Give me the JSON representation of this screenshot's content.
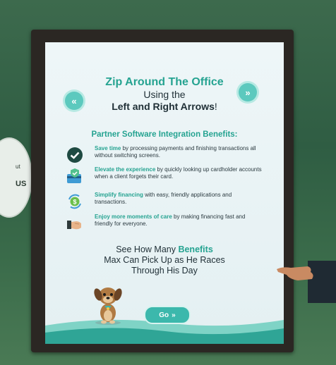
{
  "screen": {
    "title_line1": "Zip Around The Office",
    "title_line2": "Using the",
    "title_line3_bold": "Left and Right Arrows",
    "title_line3_end": "!",
    "arrow_left": "«",
    "arrow_right": "»",
    "benefits_heading": "Partner Software Integration Benefits:",
    "benefits": [
      {
        "icon": "check-circle-icon",
        "highlight": "Save time",
        "rest": " by processing payments and finishing transactions all without switching screens."
      },
      {
        "icon": "shield-card-icon",
        "highlight": "Elevate the experience",
        "rest": " by quickly looking up cardholder accounts when a client forgets their card."
      },
      {
        "icon": "refresh-dollar-icon",
        "highlight": "Simplify financing",
        "rest": " with easy, friendly applications and transactions."
      },
      {
        "icon": "handshake-icon",
        "highlight": "Enjoy more moments of care",
        "rest": " by making financing fast and friendly for everyone."
      }
    ],
    "see_line1_a": "See How Many ",
    "see_line1_hl": "Benefits",
    "see_line2": "Max Can Pick Up as He Races",
    "see_line3": "Through His Day",
    "go_label": "Go",
    "go_arrows": "»"
  },
  "wall": {
    "left_small": "ut",
    "left_text": "US"
  },
  "colors": {
    "accent": "#25a391",
    "button": "#3cb8ac",
    "frame": "#2b2723",
    "wall": "#2f5d43"
  }
}
